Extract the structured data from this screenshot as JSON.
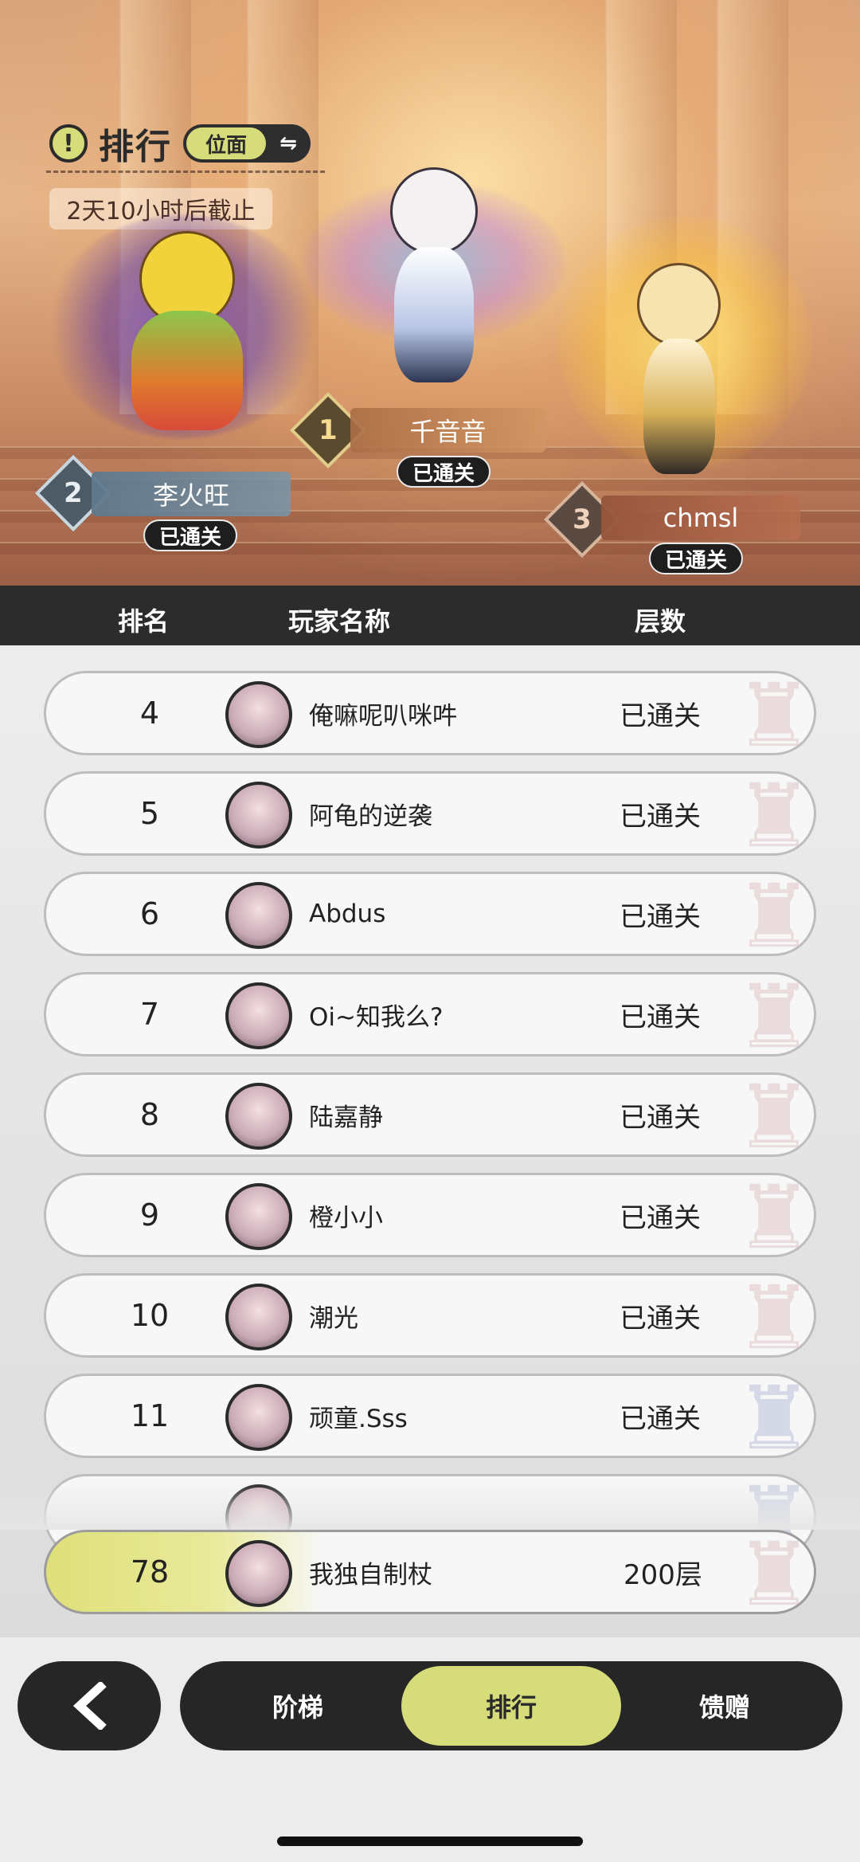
{
  "header": {
    "title": "排行",
    "scope_label": "位面",
    "deadline": "2天10小时后截止"
  },
  "podium": [
    {
      "rank": "1",
      "name": "千音音",
      "status": "已通关"
    },
    {
      "rank": "2",
      "name": "李火旺",
      "status": "已通关"
    },
    {
      "rank": "3",
      "name": "chmsl",
      "status": "已通关"
    }
  ],
  "columns": {
    "rank": "排名",
    "player": "玩家名称",
    "floors": "层数"
  },
  "rows": [
    {
      "rank": "4",
      "name": "俺嘛呢叭咪吽",
      "status": "已通关"
    },
    {
      "rank": "5",
      "name": "阿龟的逆袭",
      "status": "已通关"
    },
    {
      "rank": "6",
      "name": "Abdus",
      "status": "已通关"
    },
    {
      "rank": "7",
      "name": "Oi~知我么?",
      "status": "已通关"
    },
    {
      "rank": "8",
      "name": "陆嘉静",
      "status": "已通关"
    },
    {
      "rank": "9",
      "name": "橙小小",
      "status": "已通关"
    },
    {
      "rank": "10",
      "name": "潮光",
      "status": "已通关"
    },
    {
      "rank": "11",
      "name": "顽童.Sss",
      "status": "已通关"
    }
  ],
  "my_row": {
    "rank": "78",
    "name": "我独自制杖",
    "floors": "200层"
  },
  "nav": {
    "tabs": [
      "阶梯",
      "排行",
      "馈赠"
    ],
    "active_tab": "排行"
  },
  "colors": {
    "accent": "#d6dc7a",
    "dark": "#262626"
  },
  "icons": [
    "alert-icon",
    "swap-icon",
    "back-arrow-icon"
  ]
}
